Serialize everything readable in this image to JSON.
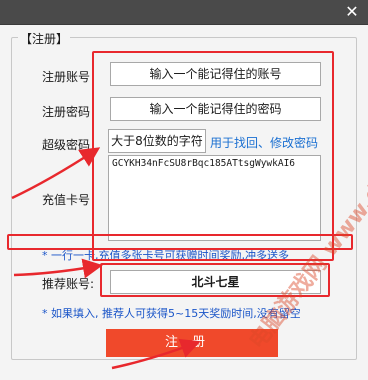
{
  "window": {
    "close_symbol": "✕"
  },
  "group": {
    "title": "【注册】"
  },
  "form": {
    "account_label": "注册账号",
    "account_value": "输入一个能记得住的账号",
    "password_label": "注册密码",
    "password_value": "输入一个能记得住的密码",
    "superpass_label": "超级密码",
    "superpass_value": "大于8位数的字符",
    "superpass_link": "用于找回、修改密码",
    "card_label": "充值卡号",
    "card_value": "GCYKH34nFcSU8rBqc185ATtsgWywkAI6",
    "hint1": "* 一行一卡,充值多张卡号可获赠时间奖励,冲多送多",
    "referrer_label": "推荐账号:",
    "referrer_value": "北斗七星",
    "hint2": "* 如果填入, 推荐人可获得5~15天奖励时间,没有留空",
    "submit_label": "注册"
  },
  "watermark": "电脑游戏网 www.dn6.com",
  "colors": {
    "annotation_red": "#e8282d",
    "button_orange": "#f0492b",
    "hint_blue": "#1a55c8",
    "link_blue": "#1a6fd1"
  },
  "icons": [
    "close-icon",
    "arrow-icon"
  ]
}
